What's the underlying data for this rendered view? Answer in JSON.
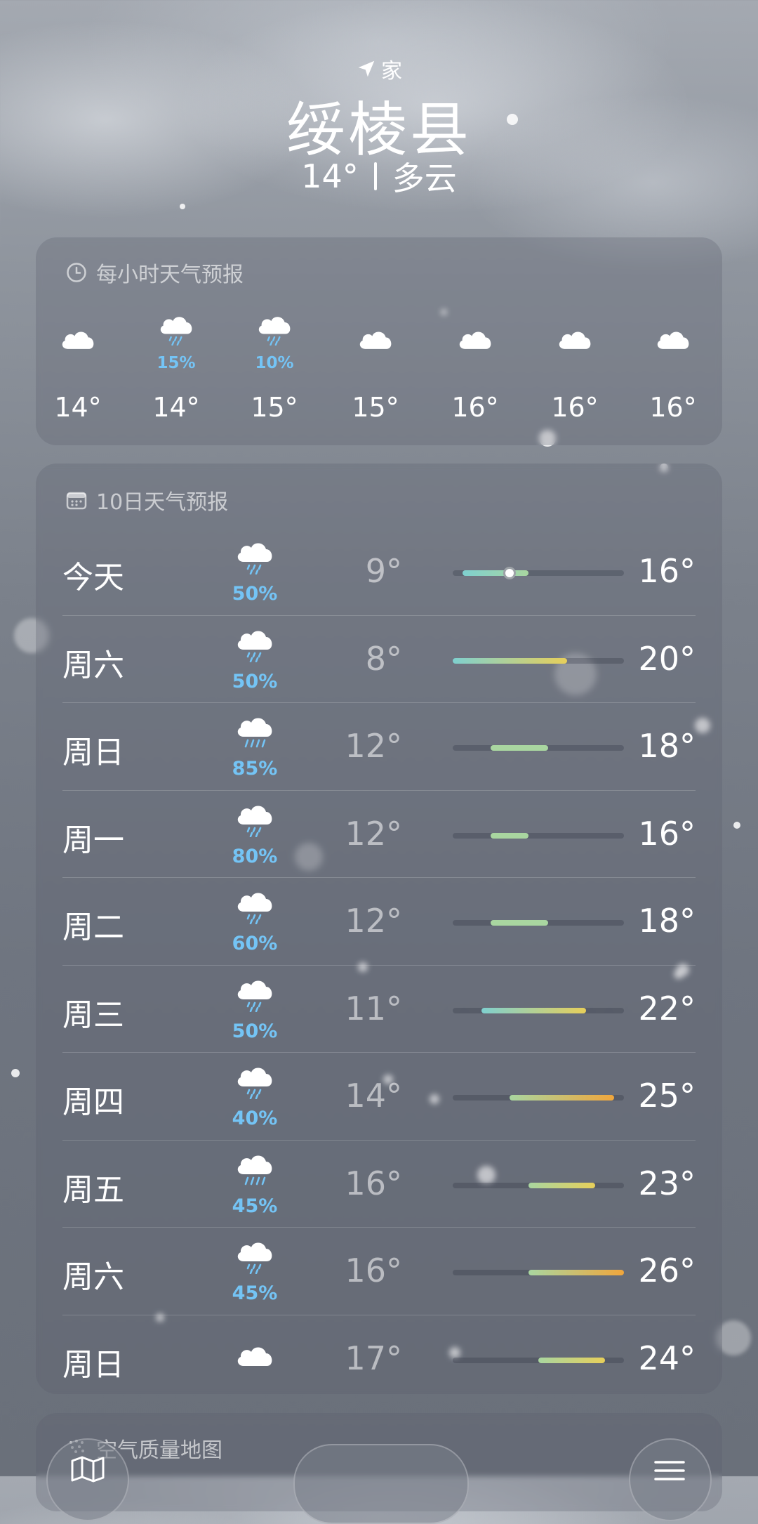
{
  "header": {
    "location_label": "家",
    "city": "绥棱县",
    "current_temp": "14°",
    "condition": "多云"
  },
  "hourly": {
    "title": "每小时天气预报",
    "items": [
      {
        "icon": "cloud-icon",
        "precip": "",
        "temp": "14°"
      },
      {
        "icon": "cloud-rain-icon",
        "precip": "15%",
        "temp": "14°"
      },
      {
        "icon": "cloud-rain-icon",
        "precip": "10%",
        "temp": "15°"
      },
      {
        "icon": "cloud-icon",
        "precip": "",
        "temp": "15°"
      },
      {
        "icon": "cloud-icon",
        "precip": "",
        "temp": "16°"
      },
      {
        "icon": "cloud-icon",
        "precip": "",
        "temp": "16°"
      },
      {
        "icon": "cloud-icon",
        "precip": "",
        "temp": "16°"
      }
    ]
  },
  "daily": {
    "title": "10日天气预报",
    "range_min": 8,
    "range_max": 26,
    "current_temp_value": 14,
    "colors": {
      "cool": "#7fd0cf",
      "mild": "#a9d6a0",
      "warm": "#e7cf5a",
      "hot": "#f0a63c"
    },
    "items": [
      {
        "day": "今天",
        "icon": "cloud-rain-icon",
        "precip": "50%",
        "low": "9°",
        "high": "16°",
        "low_val": 9,
        "high_val": 16,
        "current": true
      },
      {
        "day": "周六",
        "icon": "cloud-rain-icon",
        "precip": "50%",
        "low": "8°",
        "high": "20°",
        "low_val": 8,
        "high_val": 20
      },
      {
        "day": "周日",
        "icon": "cloud-heavy-rain-icon",
        "precip": "85%",
        "low": "12°",
        "high": "18°",
        "low_val": 12,
        "high_val": 18
      },
      {
        "day": "周一",
        "icon": "cloud-rain-icon",
        "precip": "80%",
        "low": "12°",
        "high": "16°",
        "low_val": 12,
        "high_val": 16
      },
      {
        "day": "周二",
        "icon": "cloud-rain-icon",
        "precip": "60%",
        "low": "12°",
        "high": "18°",
        "low_val": 12,
        "high_val": 18
      },
      {
        "day": "周三",
        "icon": "cloud-rain-icon",
        "precip": "50%",
        "low": "11°",
        "high": "22°",
        "low_val": 11,
        "high_val": 22
      },
      {
        "day": "周四",
        "icon": "cloud-rain-icon",
        "precip": "40%",
        "low": "14°",
        "high": "25°",
        "low_val": 14,
        "high_val": 25
      },
      {
        "day": "周五",
        "icon": "cloud-heavy-rain-icon",
        "precip": "45%",
        "low": "16°",
        "high": "23°",
        "low_val": 16,
        "high_val": 23
      },
      {
        "day": "周六",
        "icon": "cloud-rain-icon",
        "precip": "45%",
        "low": "16°",
        "high": "26°",
        "low_val": 16,
        "high_val": 26
      },
      {
        "day": "周日",
        "icon": "cloud-icon",
        "precip": "",
        "low": "17°",
        "high": "24°",
        "low_val": 17,
        "high_val": 24
      }
    ]
  },
  "air_quality": {
    "title": "空气质量地图"
  },
  "toolbar": {
    "map_icon": "map-icon",
    "list_icon": "list-icon"
  }
}
